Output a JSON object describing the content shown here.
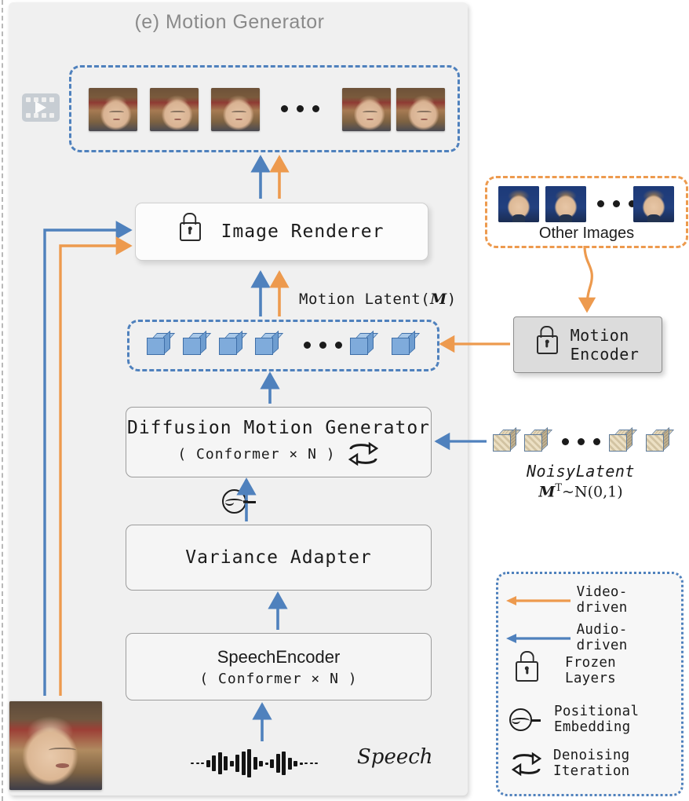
{
  "figure": {
    "title": "(e) Motion Generator",
    "colors": {
      "audio_blue": "#4f81bd",
      "video_orange": "#ed9a4e",
      "panel_bg": "#f0f0f0",
      "cube_blue": "#7fabdb",
      "noisy_cube": "#e8dcc0"
    }
  },
  "video_frames": {
    "icon": "film-play-icon",
    "count_shown": 5,
    "ellipsis": "..."
  },
  "image_renderer": {
    "label": "Image Renderer",
    "icon": "lock-icon"
  },
  "motion_latent": {
    "label_prefix": "Motion Latent",
    "label_symbol": "M",
    "label_open": "(",
    "label_close": ")",
    "cubes_shown": 6,
    "ellipsis": "..."
  },
  "diffusion_motion_generator": {
    "title": "Diffusion Motion Generator",
    "subtitle": "( Conformer × N )",
    "icon": "denoising-iteration-icon"
  },
  "variance_adapter": {
    "title": "Variance Adapter"
  },
  "speech_encoder": {
    "title": "SpeechEncoder",
    "subtitle": "( Conformer × N )"
  },
  "speech_input": {
    "label": "Speech",
    "icon": "waveform-icon"
  },
  "positional_embedding": {
    "icon": "positional-embedding-icon"
  },
  "other_images": {
    "caption": "Other Images",
    "thumbs_shown": 3,
    "ellipsis": "..."
  },
  "motion_encoder": {
    "line1": "Motion",
    "line2": "Encoder",
    "icon": "lock-icon"
  },
  "noisy_latent": {
    "title": "NoisyLatent",
    "formula_m": "M",
    "formula_sup": "T",
    "formula_rest": "~N(0,1)",
    "cubes_shown": 4,
    "ellipsis": "..."
  },
  "reference_image": {
    "name": "reference-face-image"
  },
  "legend": {
    "items": [
      {
        "label": "Video-driven",
        "kind": "orange-arrow"
      },
      {
        "label": "Audio-driven",
        "kind": "blue-arrow"
      },
      {
        "label": "Frozen\nLayers",
        "line1": "Frozen",
        "line2": "Layers",
        "kind": "lock-icon"
      },
      {
        "label": "Positional\nEmbedding",
        "line1": "Positional",
        "line2": "Embedding",
        "kind": "positional-embedding-icon"
      },
      {
        "label": "Denoising\nIteration",
        "line1": "Denoising",
        "line2": "Iteration",
        "kind": "denoising-iteration-icon"
      }
    ]
  }
}
